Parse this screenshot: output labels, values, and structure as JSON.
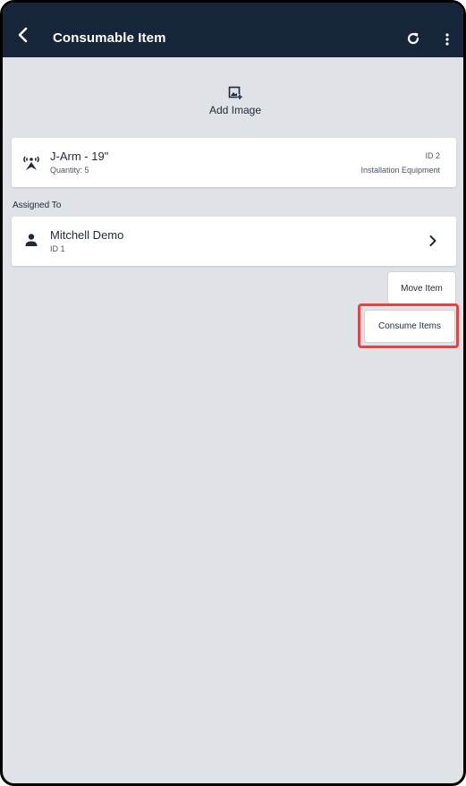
{
  "appbar": {
    "title": "Consumable Item",
    "back_icon": "chevron-left-icon",
    "refresh_icon": "refresh-icon",
    "more_icon": "more-vertical-icon",
    "background": "#17253a"
  },
  "add_image": {
    "label": "Add Image",
    "icon": "add-photo-icon"
  },
  "item": {
    "icon": "broadcast-mount-icon",
    "name": "J-Arm - 19\"",
    "quantity": "Quantity: 5",
    "id": "ID 2",
    "category": "Installation Equipment"
  },
  "assigned": {
    "section_label": "Assigned To",
    "icon": "person-icon",
    "name": "Mitchell Demo",
    "id": "ID 1",
    "chevron": "chevron-right-icon"
  },
  "actions": {
    "move_label": "Move Item",
    "consume_label": "Consume Items",
    "highlight_color": "#e04646"
  },
  "colors": {
    "page_background": "#dfe2e7",
    "card_background": "#ffffff",
    "text": "#1f2a37"
  }
}
